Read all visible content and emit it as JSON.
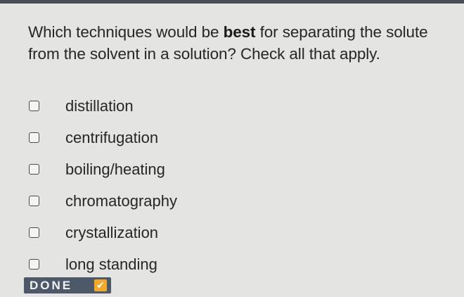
{
  "question": {
    "before_bold": "Which techniques would be ",
    "bold": "best",
    "after_bold": " for separating the solute from the solvent in a solution? Check all that apply."
  },
  "options": [
    {
      "label": "distillation",
      "checked": false
    },
    {
      "label": "centrifugation",
      "checked": false
    },
    {
      "label": "boiling/heating",
      "checked": false
    },
    {
      "label": "chromatography",
      "checked": false
    },
    {
      "label": "crystallization",
      "checked": false
    },
    {
      "label": "long standing",
      "checked": false
    }
  ],
  "done_button": {
    "label": "DONE",
    "icon": "checkmark-icon",
    "check_glyph": "✔"
  },
  "colors": {
    "background": "#e4e4e2",
    "done_button": "#4d5868",
    "check_accent": "#f0a92a"
  }
}
